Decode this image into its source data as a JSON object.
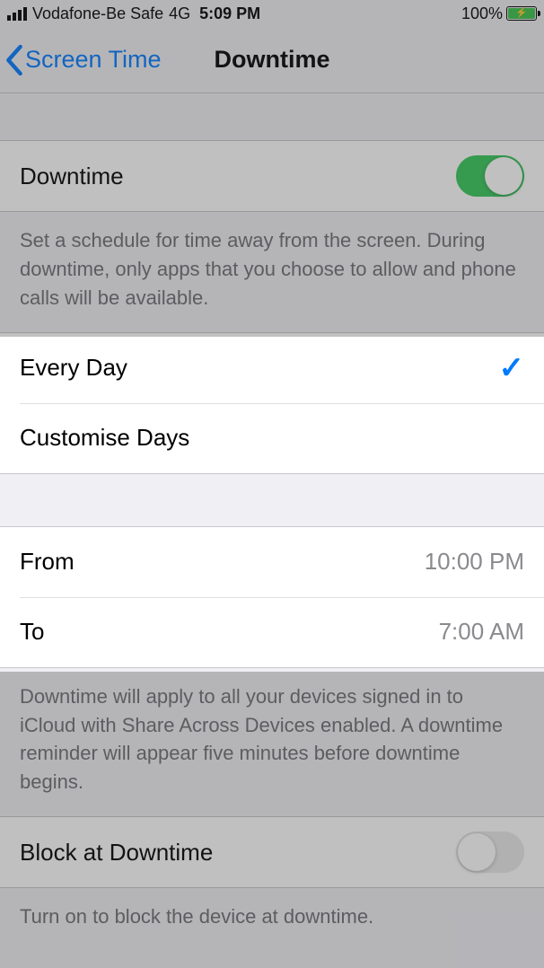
{
  "status": {
    "carrier": "Vodafone-Be Safe",
    "network": "4G",
    "time": "5:09 PM",
    "battery_pct": "100%"
  },
  "nav": {
    "back_label": "Screen Time",
    "title": "Downtime"
  },
  "downtime_toggle": {
    "label": "Downtime",
    "description": "Set a schedule for time away from the screen. During downtime, only apps that you choose to allow and phone calls will be available."
  },
  "schedule_mode": {
    "every_day": "Every Day",
    "customise": "Customise Days"
  },
  "times": {
    "from_label": "From",
    "from_value": "10:00 PM",
    "to_label": "To",
    "to_value": "7:00 AM",
    "footer": "Downtime will apply to all your devices signed in to iCloud with Share Across Devices enabled. A downtime reminder will appear five minutes before downtime begins."
  },
  "block": {
    "label": "Block at Downtime",
    "footer": "Turn on to block the device at downtime."
  }
}
